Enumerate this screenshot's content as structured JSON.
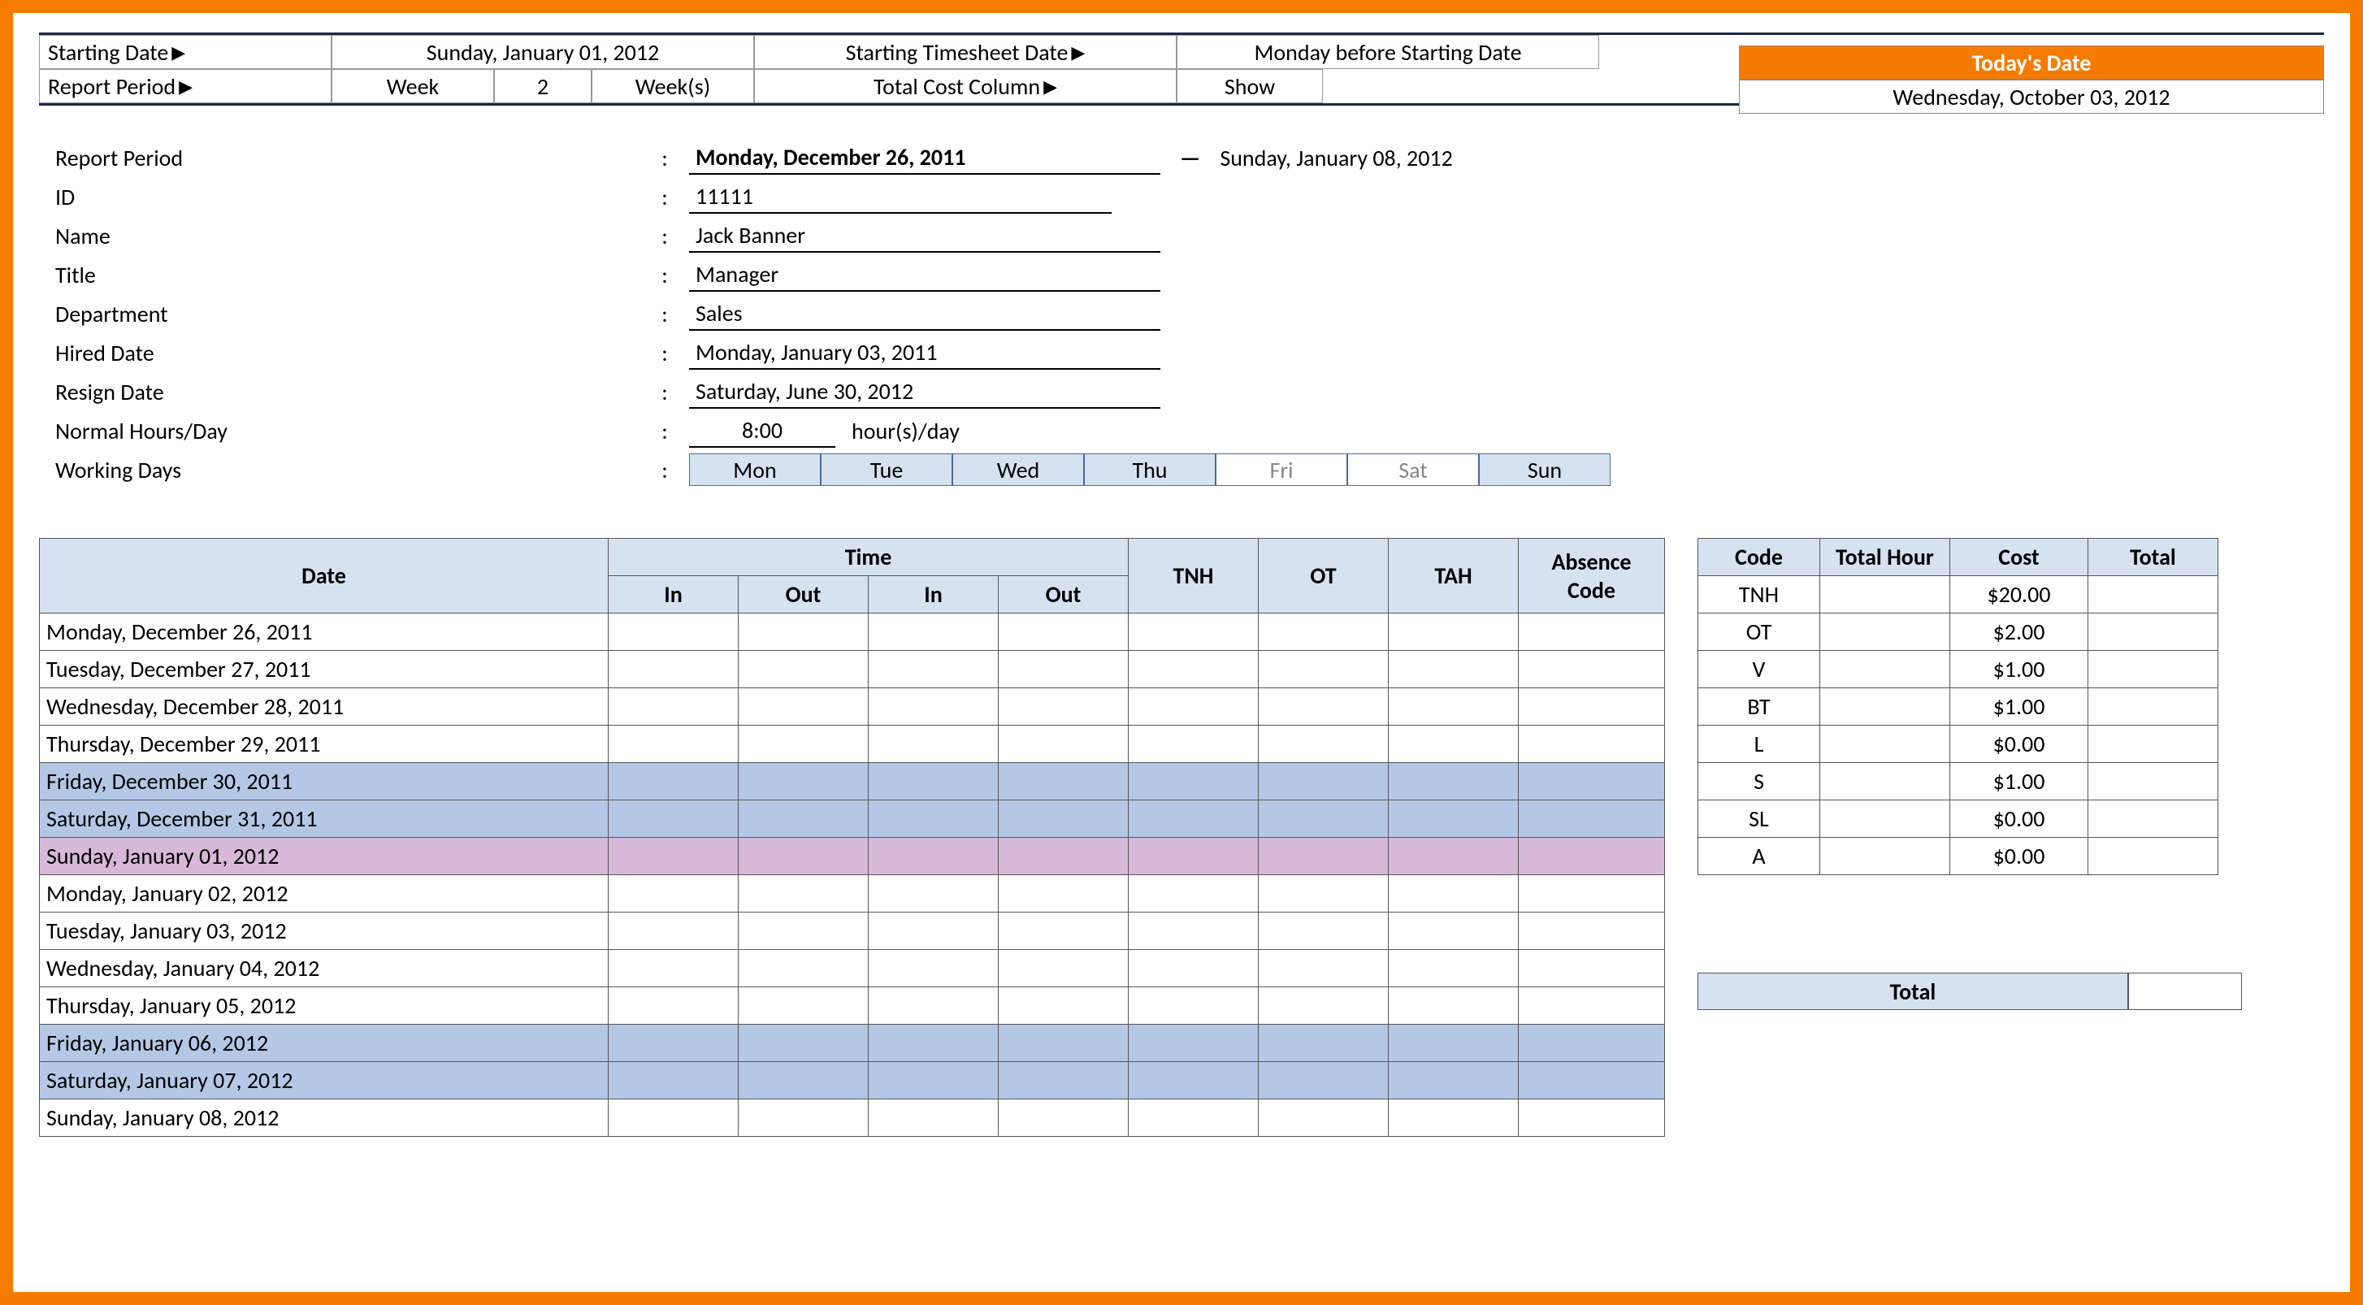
{
  "config": {
    "starting_date_label": "Starting Date",
    "starting_date_value": "Sunday, January 01, 2012",
    "timesheet_date_label": "Starting Timesheet Date",
    "timesheet_date_value": "Monday before Starting Date",
    "report_period_label": "Report Period",
    "report_period_unit": "Week",
    "report_period_value": "2",
    "report_period_suffix": "Week(s)",
    "total_cost_label": "Total Cost Column",
    "total_cost_value": "Show",
    "todays_date_label": "Today's Date",
    "todays_date_value": "Wednesday, October 03, 2012"
  },
  "info": {
    "report_period_label": "Report Period",
    "period_start": "Monday, December 26, 2011",
    "period_end": "Sunday, January 08, 2012",
    "id_label": "ID",
    "id_value": "11111",
    "name_label": "Name",
    "name_value": "Jack Banner",
    "title_label": "Title",
    "title_value": "Manager",
    "dept_label": "Department",
    "dept_value": "Sales",
    "hired_label": "Hired Date",
    "hired_value": "Monday, January 03, 2011",
    "resign_label": "Resign Date",
    "resign_value": "Saturday, June 30, 2012",
    "normal_label": "Normal Hours/Day",
    "normal_value": "8:00",
    "normal_suffix": "hour(s)/day",
    "working_label": "Working Days",
    "days": [
      "Mon",
      "Tue",
      "Wed",
      "Thu",
      "Fri",
      "Sat",
      "Sun"
    ],
    "days_off": [
      false,
      false,
      false,
      false,
      true,
      true,
      false
    ]
  },
  "timesheet": {
    "headers": {
      "date": "Date",
      "time": "Time",
      "in": "In",
      "out": "Out",
      "tnh": "TNH",
      "ot": "OT",
      "tah": "TAH",
      "absence": "Absence Code"
    },
    "rows": [
      {
        "date": "Monday, December 26, 2011",
        "cls": ""
      },
      {
        "date": "Tuesday, December 27, 2011",
        "cls": ""
      },
      {
        "date": "Wednesday, December 28, 2011",
        "cls": ""
      },
      {
        "date": "Thursday, December 29, 2011",
        "cls": ""
      },
      {
        "date": "Friday, December 30, 2011",
        "cls": "row-weekend"
      },
      {
        "date": "Saturday, December 31, 2011",
        "cls": "row-weekend"
      },
      {
        "date": "Sunday, January 01, 2012",
        "cls": "row-sunday"
      },
      {
        "date": "Monday, January 02, 2012",
        "cls": ""
      },
      {
        "date": "Tuesday, January 03, 2012",
        "cls": ""
      },
      {
        "date": "Wednesday, January 04, 2012",
        "cls": ""
      },
      {
        "date": "Thursday, January 05, 2012",
        "cls": ""
      },
      {
        "date": "Friday, January 06, 2012",
        "cls": "row-weekend"
      },
      {
        "date": "Saturday, January 07, 2012",
        "cls": "row-weekend"
      },
      {
        "date": "Sunday, January 08, 2012",
        "cls": ""
      }
    ]
  },
  "cost": {
    "headers": {
      "code": "Code",
      "total_hour": "Total Hour",
      "cost": "Cost",
      "total": "Total"
    },
    "rows": [
      {
        "code": "TNH",
        "cost": "$20.00"
      },
      {
        "code": "OT",
        "cost": "$2.00"
      },
      {
        "code": "V",
        "cost": "$1.00"
      },
      {
        "code": "BT",
        "cost": "$1.00"
      },
      {
        "code": "L",
        "cost": "$0.00"
      },
      {
        "code": "S",
        "cost": "$1.00"
      },
      {
        "code": "SL",
        "cost": "$0.00"
      },
      {
        "code": "A",
        "cost": "$0.00"
      }
    ],
    "total_label": "Total"
  }
}
